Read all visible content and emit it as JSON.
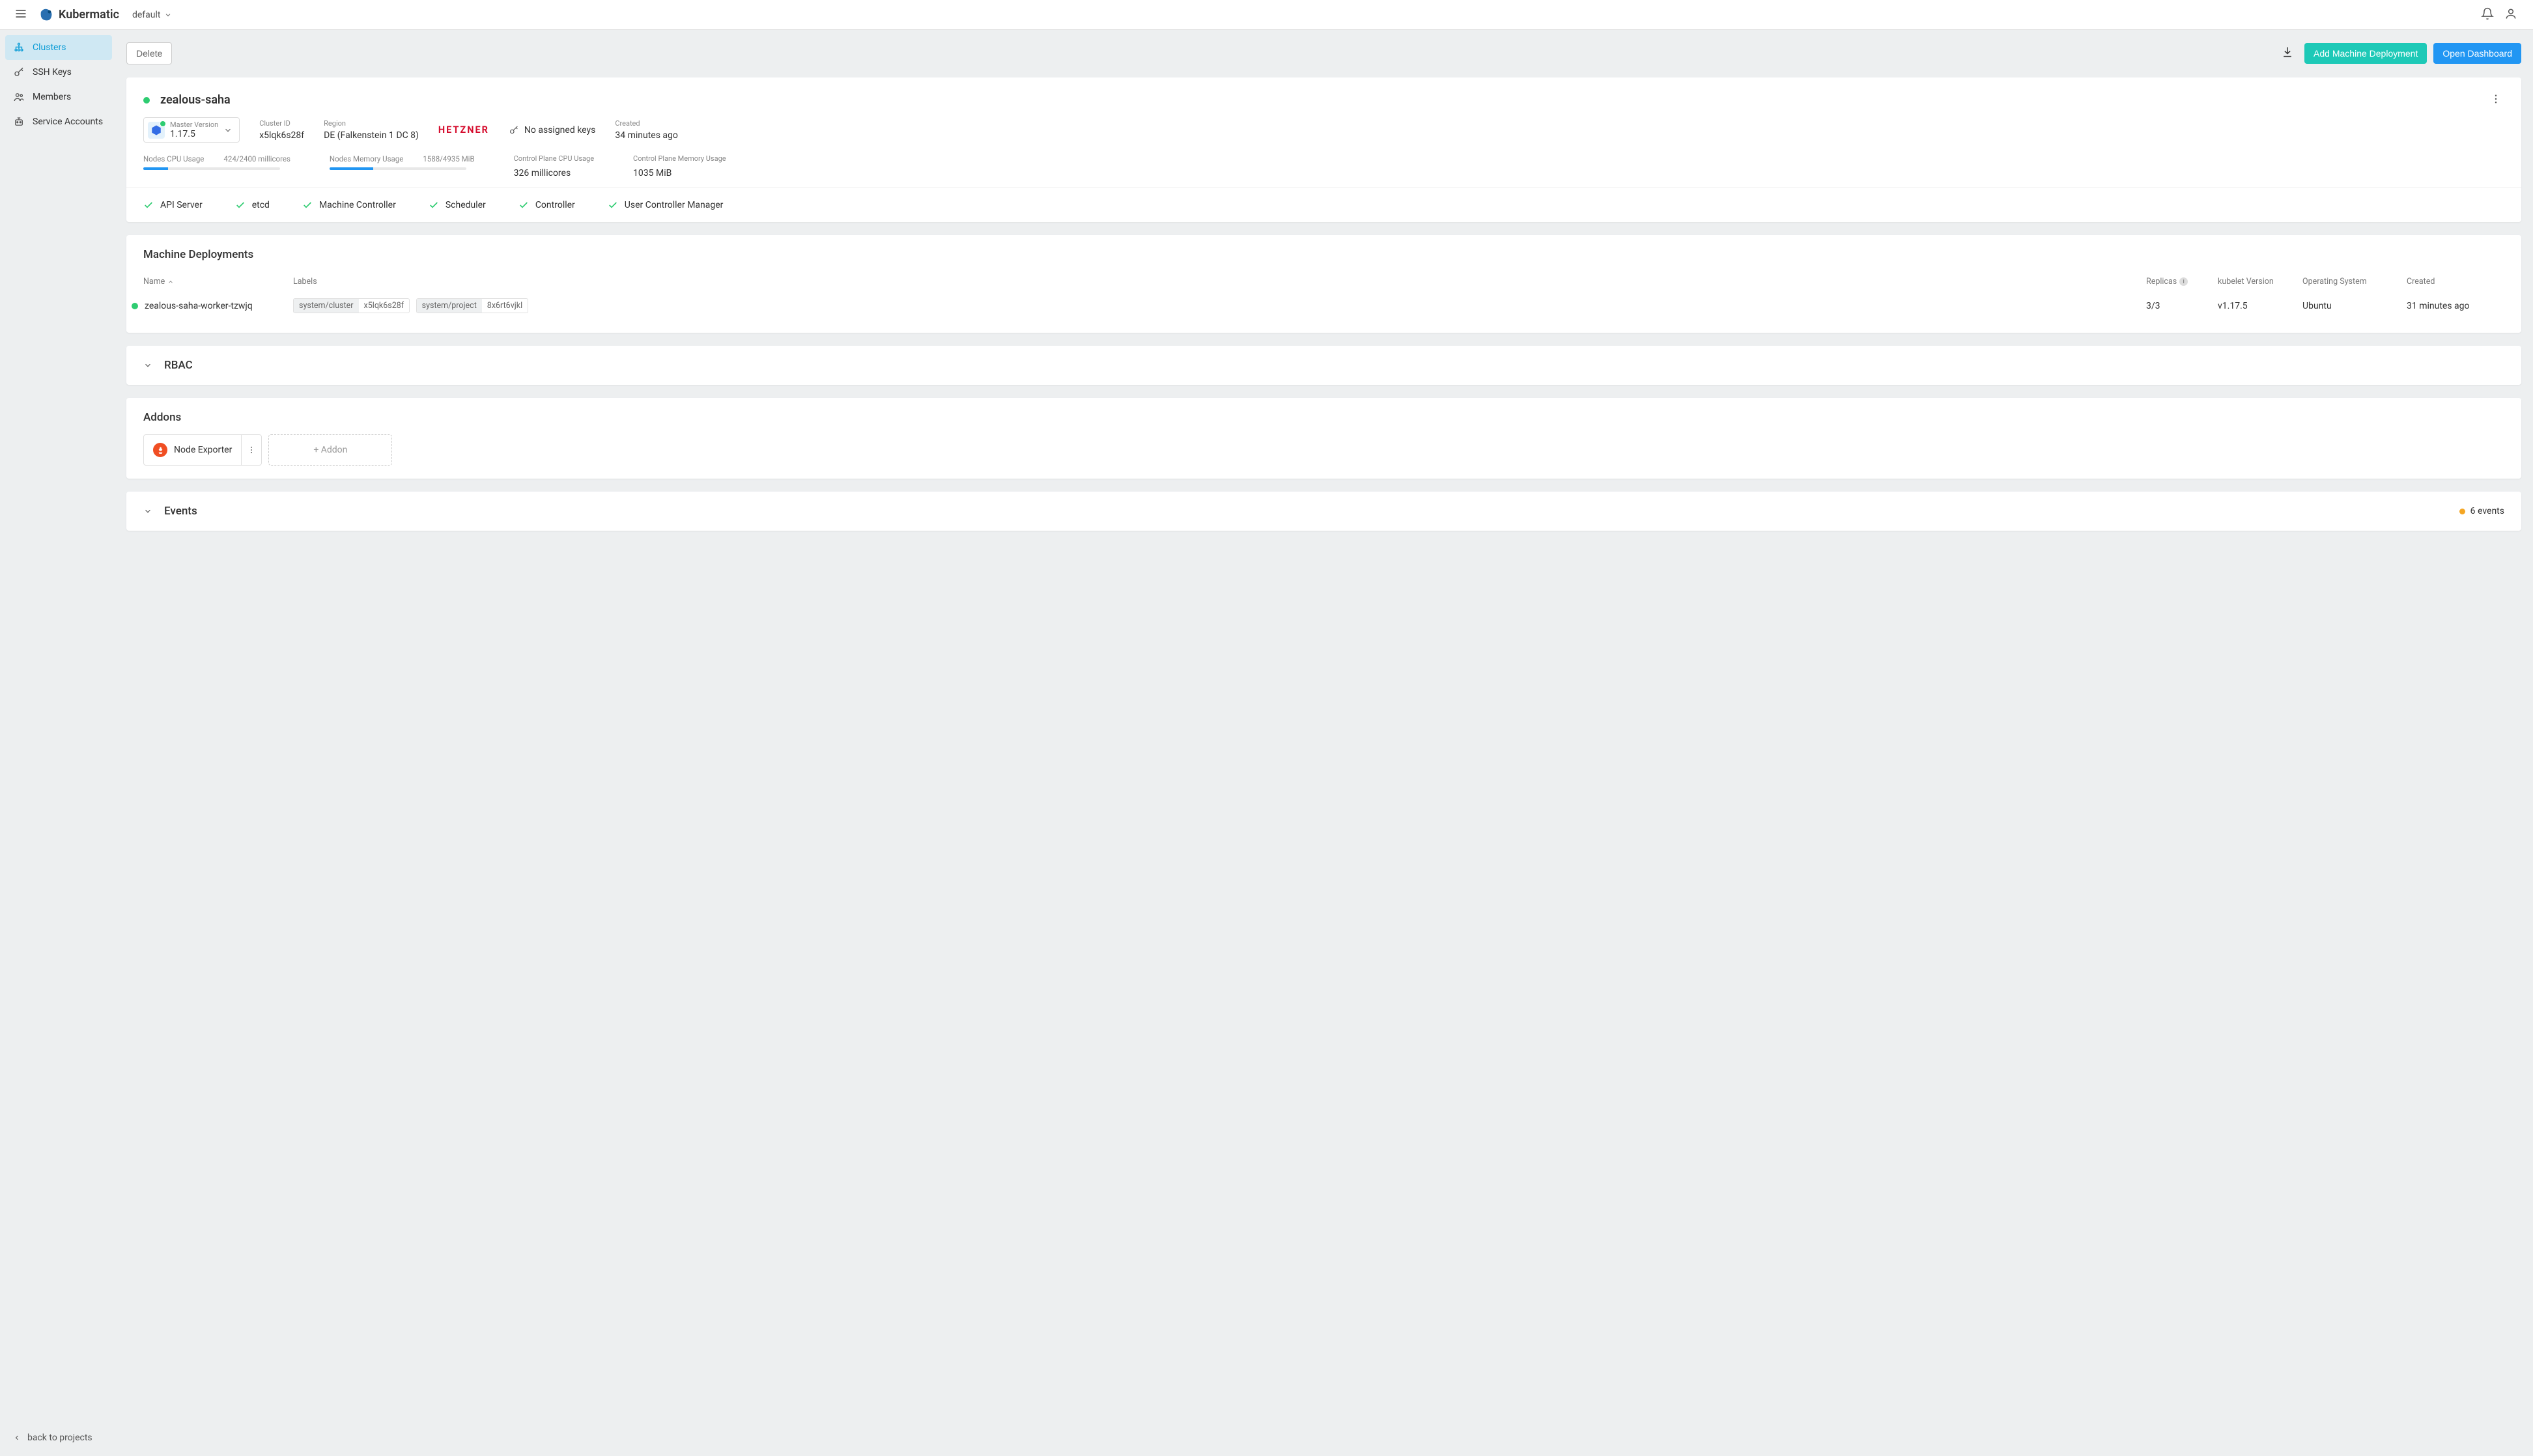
{
  "header": {
    "brand": "Kubermatic",
    "project": "default"
  },
  "sidebar": {
    "items": [
      {
        "label": "Clusters"
      },
      {
        "label": "SSH Keys"
      },
      {
        "label": "Members"
      },
      {
        "label": "Service Accounts"
      }
    ],
    "back": "back to projects"
  },
  "toolbar": {
    "delete": "Delete",
    "add_md": "Add Machine Deployment",
    "open_dash": "Open Dashboard"
  },
  "cluster": {
    "name": "zealous-saha",
    "master_version_label": "Master Version",
    "master_version": "1.17.5",
    "cluster_id_label": "Cluster ID",
    "cluster_id": "x5lqk6s28f",
    "region_label": "Region",
    "region": "DE (Falkenstein 1 DC 8)",
    "provider": "HETZNER",
    "keys": "No assigned keys",
    "created_label": "Created",
    "created": "34 minutes ago",
    "usage": {
      "cpu_label": "Nodes CPU Usage",
      "cpu_text": "424/2400 millicores",
      "cpu_pct": 18,
      "mem_label": "Nodes Memory Usage",
      "mem_text": "1588/4935 MiB",
      "mem_pct": 32,
      "cp_cpu_label": "Control Plane CPU Usage",
      "cp_cpu": "326 millicores",
      "cp_mem_label": "Control Plane Memory Usage",
      "cp_mem": "1035 MiB"
    },
    "health": [
      "API Server",
      "etcd",
      "Machine Controller",
      "Scheduler",
      "Controller",
      "User Controller Manager"
    ]
  },
  "md": {
    "title": "Machine Deployments",
    "cols": {
      "name": "Name",
      "labels": "Labels",
      "replicas": "Replicas",
      "kubelet": "kubelet Version",
      "os": "Operating System",
      "created": "Created"
    },
    "row": {
      "name": "zealous-saha-worker-tzwjq",
      "label1_k": "system/cluster",
      "label1_v": "x5lqk6s28f",
      "label2_k": "system/project",
      "label2_v": "8x6rt6vjkl",
      "replicas": "3/3",
      "kubelet": "v1.17.5",
      "os": "Ubuntu",
      "created": "31 minutes ago"
    }
  },
  "rbac": {
    "title": "RBAC"
  },
  "addons": {
    "title": "Addons",
    "item": "Node Exporter",
    "add": "+ Addon"
  },
  "events": {
    "title": "Events",
    "count": "6 events"
  }
}
